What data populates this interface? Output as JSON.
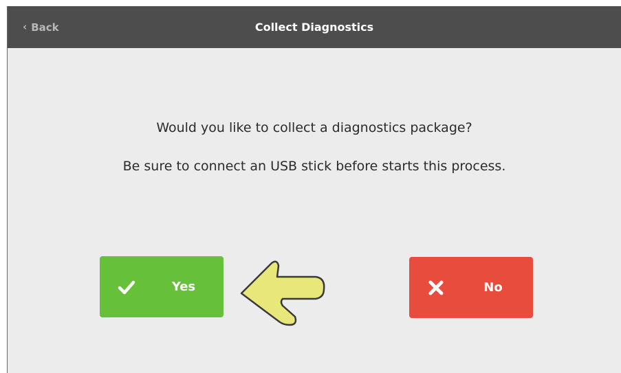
{
  "header": {
    "back_label": "Back",
    "title": "Collect Diagnostics"
  },
  "dialog": {
    "question": "Would you like to collect a diagnostics package?",
    "note": "Be sure to connect an USB stick before starts this process."
  },
  "buttons": {
    "yes": {
      "label": "Yes",
      "icon": "checkmark-icon",
      "color": "#67c03a"
    },
    "no": {
      "label": "No",
      "icon": "x-icon",
      "color": "#e74c3c"
    }
  },
  "annotation": {
    "icon": "arrow-left-icon",
    "color": "#e8e87a"
  }
}
